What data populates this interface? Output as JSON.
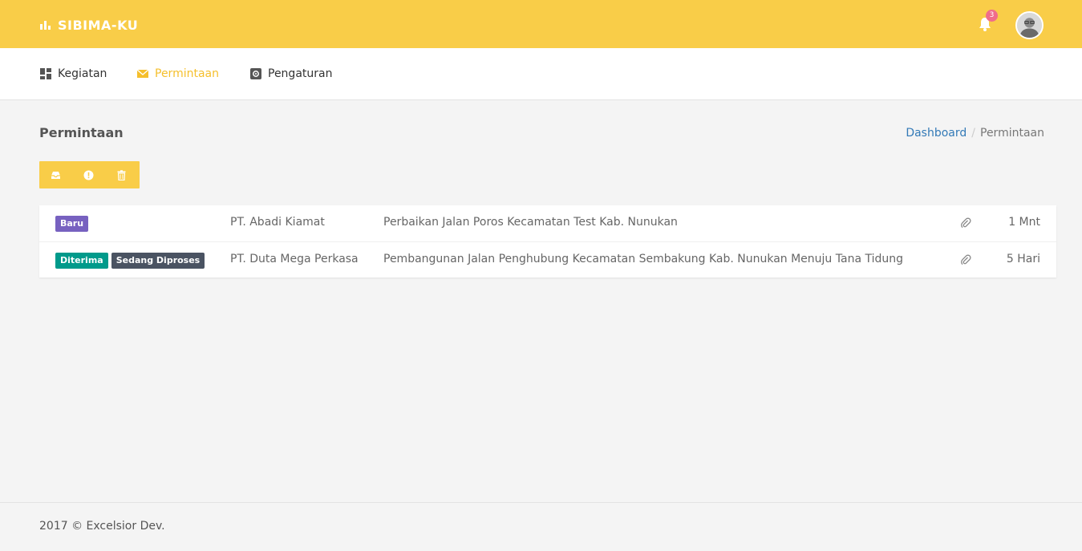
{
  "app": {
    "brand": "SIBIMA-KU"
  },
  "colors": {
    "accent": "#f9cd48",
    "active_nav": "#f5bf2c",
    "badge_baru": "#7761c0",
    "badge_diterima": "#009a8b",
    "badge_sedang_diproses": "#4a5362",
    "notification_badge": "#f06c8b",
    "link": "#337ab7"
  },
  "header": {
    "notification_count": "3",
    "bell_icon": "bell-icon",
    "avatar_icon": "user-avatar"
  },
  "nav": {
    "items": [
      {
        "label": "Kegiatan",
        "icon": "dashboard-icon",
        "active": false
      },
      {
        "label": "Permintaan",
        "icon": "envelope-icon",
        "active": true
      },
      {
        "label": "Pengaturan",
        "icon": "settings-icon",
        "active": false
      }
    ]
  },
  "page": {
    "title": "Permintaan",
    "breadcrumb": {
      "link": "Dashboard",
      "separator": "/",
      "current": "Permintaan"
    }
  },
  "toolbar": {
    "buttons": [
      {
        "icon": "inbox-icon"
      },
      {
        "icon": "alert-icon"
      },
      {
        "icon": "trash-icon"
      }
    ]
  },
  "requests": [
    {
      "badges": [
        "Baru"
      ],
      "company": "PT. Abadi Kiamat",
      "subject": "Perbaikan Jalan Poros Kecamatan Test Kab. Nunukan",
      "attachment": "paperclip-icon",
      "time": "1 Mnt"
    },
    {
      "badges": [
        "Diterima",
        "Sedang Diproses"
      ],
      "company": "PT. Duta Mega Perkasa",
      "subject": "Pembangunan Jalan Penghubung Kecamatan Sembakung Kab. Nunukan Menuju Tana Tidung",
      "attachment": "paperclip-icon",
      "time": "5 Hari"
    }
  ],
  "footer": {
    "text": "2017 © Excelsior Dev."
  }
}
